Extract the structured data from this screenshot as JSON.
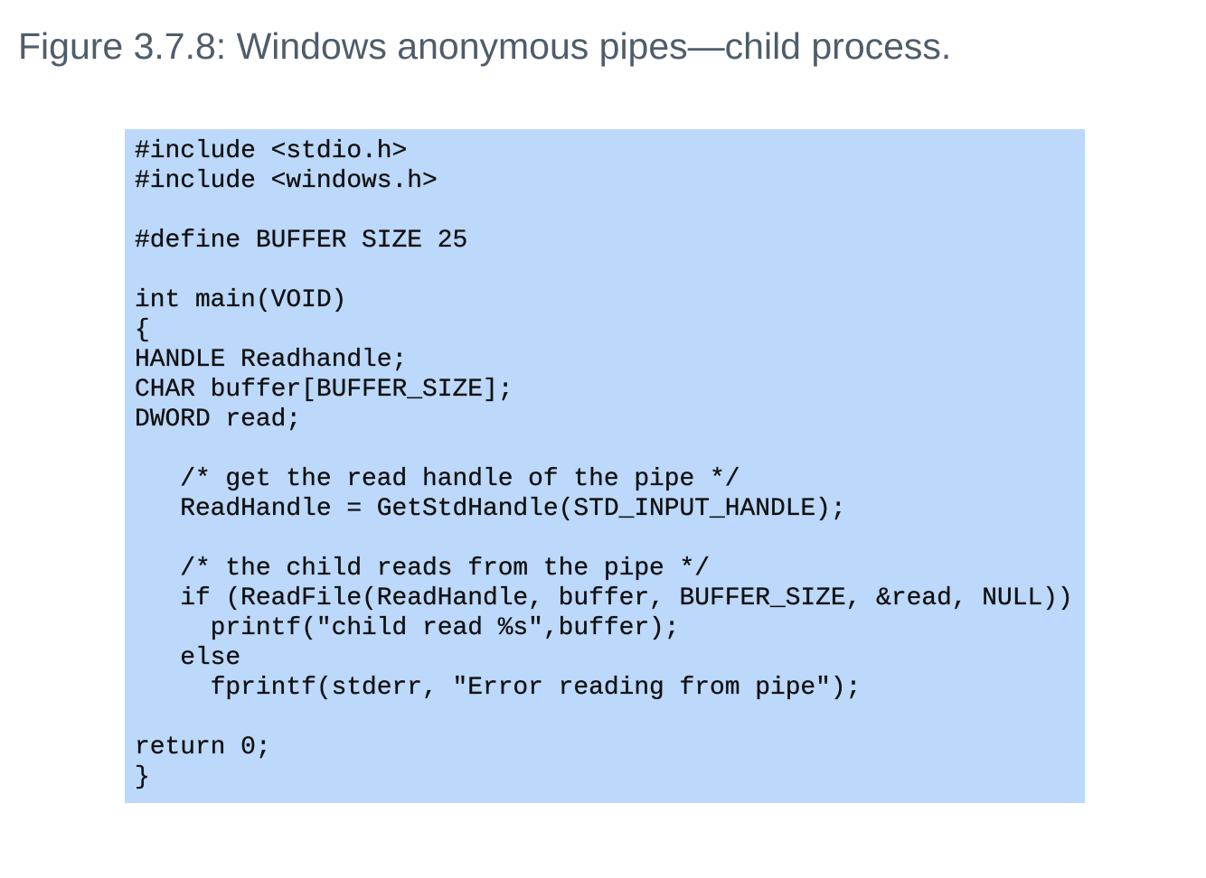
{
  "figure": {
    "caption": "Figure 3.7.8: Windows anonymous pipes—child process."
  },
  "code": {
    "lines": [
      "#include <stdio.h>",
      "#include <windows.h>",
      "",
      "#define BUFFER SIZE 25",
      "",
      "int main(VOID)",
      "{",
      "HANDLE Readhandle;",
      "CHAR buffer[BUFFER_SIZE];",
      "DWORD read;",
      "",
      "   /* get the read handle of the pipe */",
      "   ReadHandle = GetStdHandle(STD_INPUT_HANDLE);",
      "",
      "   /* the child reads from the pipe */",
      "   if (ReadFile(ReadHandle, buffer, BUFFER_SIZE, &read, NULL))",
      "     printf(\"child read %s\",buffer);",
      "   else",
      "     fprintf(stderr, \"Error reading from pipe\");",
      "",
      "return 0;",
      "}"
    ]
  }
}
